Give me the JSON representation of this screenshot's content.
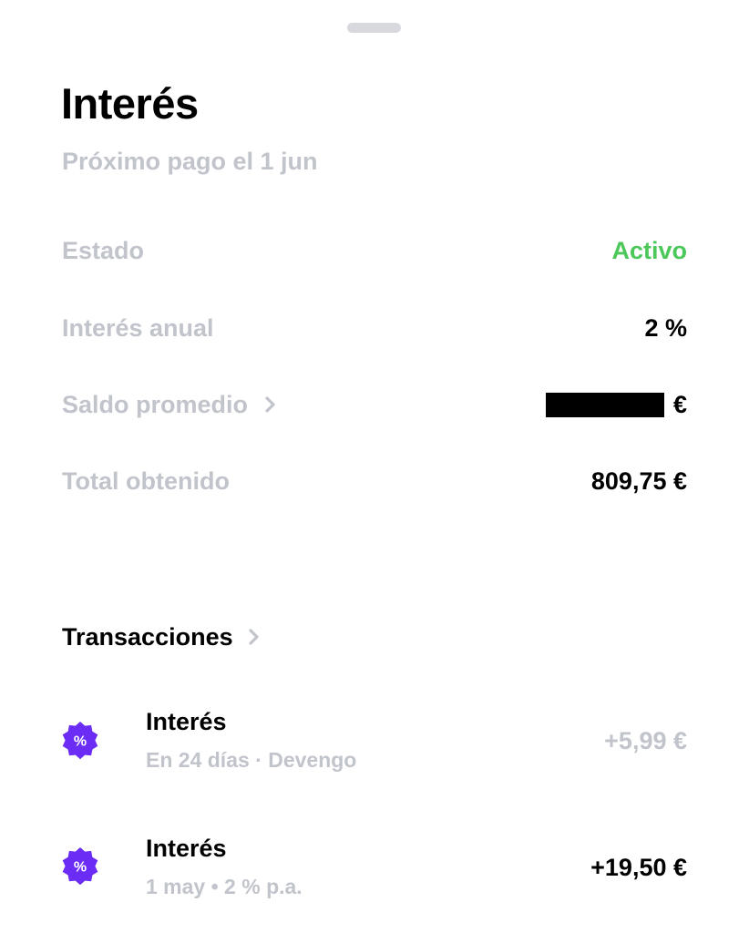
{
  "sheet": {
    "title": "Interés",
    "subtitle": "Próximo pago el 1 jun"
  },
  "details": {
    "estado": {
      "label": "Estado",
      "value": "Activo",
      "color": "#4cc85a"
    },
    "interes_anual": {
      "label": "Interés anual",
      "value": "2 %"
    },
    "saldo_promedio": {
      "label": "Saldo promedio",
      "currency": "€",
      "redacted": true
    },
    "total_obtenido": {
      "label": "Total obtenido",
      "value": "809,75 €"
    }
  },
  "transactions": {
    "header": "Transacciones",
    "items": [
      {
        "icon": "percent-badge-icon",
        "title": "Interés",
        "subtitle": "En 24 días · Devengo",
        "amount": "+5,99 €",
        "status": "pending"
      },
      {
        "icon": "percent-badge-icon",
        "title": "Interés",
        "subtitle": "1 may • 2 % p.a.",
        "amount": "+19,50 €",
        "status": "completed"
      }
    ]
  },
  "colors": {
    "accent_purple": "#6b2cf5",
    "muted_text": "#c2c4cc",
    "active_green": "#4cc85a"
  }
}
